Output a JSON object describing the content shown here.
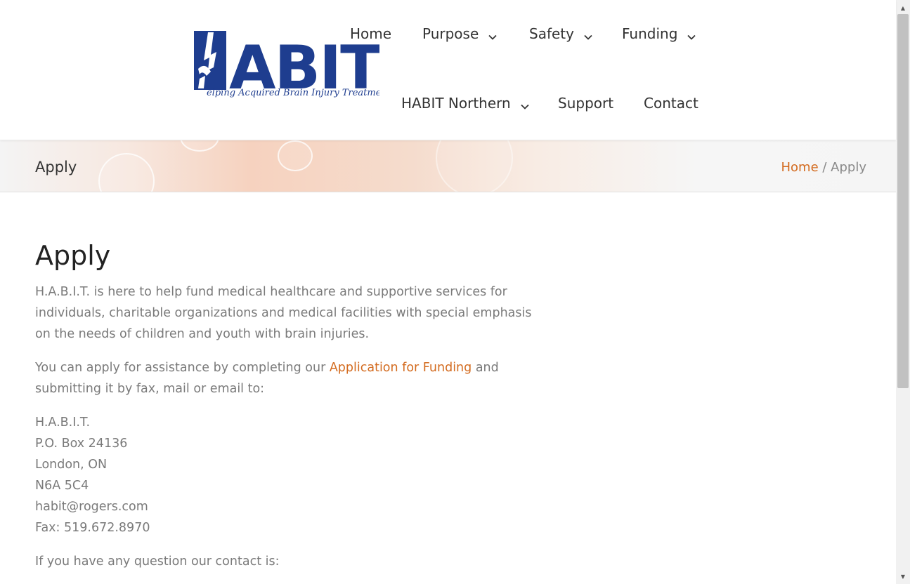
{
  "logo": {
    "main": "ABIT",
    "tagline": "elping Acquired Brain Injury Treatment",
    "colors": {
      "primary": "#1e3d8f"
    }
  },
  "nav": {
    "home": "Home",
    "purpose": "Purpose",
    "safety": "Safety",
    "funding": "Funding",
    "northern": "HABIT Northern",
    "support": "Support",
    "contact": "Contact"
  },
  "titlebar": {
    "title": "Apply",
    "breadcrumb_home": "Home",
    "breadcrumb_sep": " / ",
    "breadcrumb_current": "Apply"
  },
  "content": {
    "heading": "Apply",
    "intro": "H.A.B.I.T. is here to help fund medical healthcare and supportive services for individuals, charitable organizations and medical facilities with special emphasis on the needs of children and youth with brain injuries.",
    "apply_before": "You can apply for assistance by completing our ",
    "apply_link": "Application for Funding",
    "apply_after": " and submitting it by fax, mail or email to:",
    "address": [
      "H.A.B.I.T.",
      "P.O. Box 24136",
      "London, ON",
      "N6A 5C4",
      "habit@rogers.com",
      "Fax: 519.672.8970"
    ],
    "question": "If you have any question our contact is:"
  },
  "colors": {
    "link": "#d36b1f",
    "nav_text": "#333333",
    "body_text": "#7a7a7a"
  },
  "icons": {
    "nav_dropdown": "chevron-down-icon",
    "scroll_up": "arrow-up-icon",
    "scroll_down": "arrow-down-icon"
  }
}
